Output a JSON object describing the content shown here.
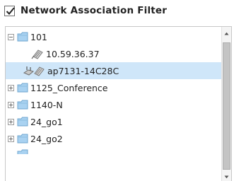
{
  "filter": {
    "label": "Network Association Filter",
    "checked": true
  },
  "tree": {
    "nodes": [
      {
        "label": "101",
        "expander": "minus",
        "icon": "folder-icon",
        "level": 0
      },
      {
        "label": "10.59.36.37",
        "icon": "network-device-icon",
        "level": 1
      },
      {
        "label": "ap7131-14C28C",
        "icon": "access-point-icon",
        "level": 1,
        "selected": true
      },
      {
        "label": "1125_Conference",
        "expander": "plus",
        "icon": "folder-icon",
        "level": 0
      },
      {
        "label": "1140-N",
        "expander": "plus",
        "icon": "folder-icon",
        "level": 0
      },
      {
        "label": "24_go1",
        "expander": "plus",
        "icon": "folder-icon",
        "level": 0
      },
      {
        "label": "24_go2",
        "expander": "plus",
        "icon": "folder-icon",
        "level": 0
      }
    ]
  },
  "colors": {
    "selection": "#cfe6f9",
    "folder": "#a9d2f1"
  }
}
